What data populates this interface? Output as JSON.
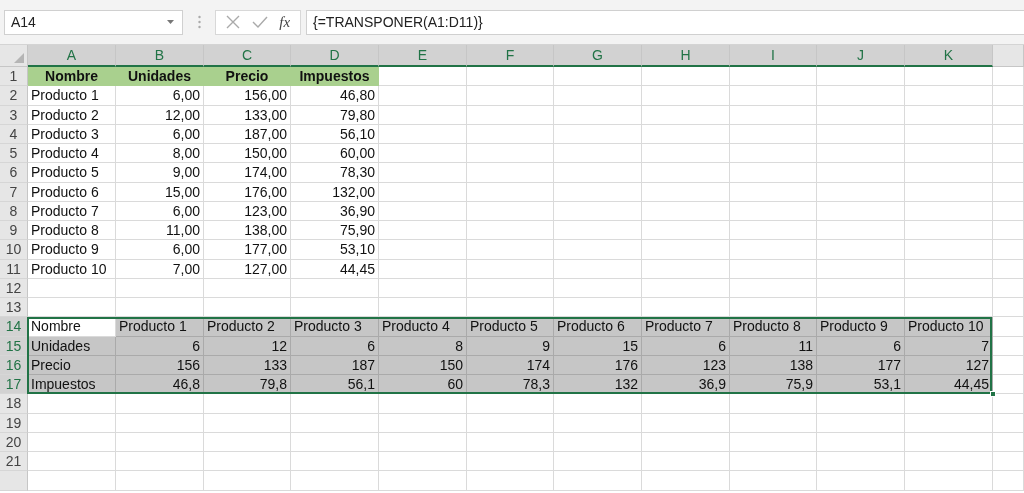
{
  "name_box": {
    "value": "A14"
  },
  "formula_bar": {
    "function_label": "fx",
    "formula": "{=TRANSPONER(A1:D11)}"
  },
  "columns": [
    {
      "letter": "A",
      "selected": true
    },
    {
      "letter": "B",
      "selected": true
    },
    {
      "letter": "C",
      "selected": true
    },
    {
      "letter": "D",
      "selected": true
    },
    {
      "letter": "E",
      "selected": true
    },
    {
      "letter": "F",
      "selected": true
    },
    {
      "letter": "G",
      "selected": true
    },
    {
      "letter": "H",
      "selected": true
    },
    {
      "letter": "I",
      "selected": true
    },
    {
      "letter": "J",
      "selected": true
    },
    {
      "letter": "K",
      "selected": true
    }
  ],
  "rows": [
    {
      "number": "1",
      "selected": false,
      "cells": [
        {
          "kind": "header",
          "text": "Nombre"
        },
        {
          "kind": "header",
          "text": "Unidades"
        },
        {
          "kind": "header",
          "text": "Precio"
        },
        {
          "kind": "header",
          "text": "Impuestos"
        }
      ]
    },
    {
      "number": "2",
      "selected": false,
      "cells": [
        {
          "kind": "text",
          "text": "Producto 1"
        },
        {
          "kind": "number",
          "text": "6,00"
        },
        {
          "kind": "number",
          "text": "156,00"
        },
        {
          "kind": "number",
          "text": "46,80"
        }
      ]
    },
    {
      "number": "3",
      "selected": false,
      "cells": [
        {
          "kind": "text",
          "text": "Producto 2"
        },
        {
          "kind": "number",
          "text": "12,00"
        },
        {
          "kind": "number",
          "text": "133,00"
        },
        {
          "kind": "number",
          "text": "79,80"
        }
      ]
    },
    {
      "number": "4",
      "selected": false,
      "cells": [
        {
          "kind": "text",
          "text": "Producto 3"
        },
        {
          "kind": "number",
          "text": "6,00"
        },
        {
          "kind": "number",
          "text": "187,00"
        },
        {
          "kind": "number",
          "text": "56,10"
        }
      ]
    },
    {
      "number": "5",
      "selected": false,
      "cells": [
        {
          "kind": "text",
          "text": "Producto 4"
        },
        {
          "kind": "number",
          "text": "8,00"
        },
        {
          "kind": "number",
          "text": "150,00"
        },
        {
          "kind": "number",
          "text": "60,00"
        }
      ]
    },
    {
      "number": "6",
      "selected": false,
      "cells": [
        {
          "kind": "text",
          "text": "Producto 5"
        },
        {
          "kind": "number",
          "text": "9,00"
        },
        {
          "kind": "number",
          "text": "174,00"
        },
        {
          "kind": "number",
          "text": "78,30"
        }
      ]
    },
    {
      "number": "7",
      "selected": false,
      "cells": [
        {
          "kind": "text",
          "text": "Producto 6"
        },
        {
          "kind": "number",
          "text": "15,00"
        },
        {
          "kind": "number",
          "text": "176,00"
        },
        {
          "kind": "number",
          "text": "132,00"
        }
      ]
    },
    {
      "number": "8",
      "selected": false,
      "cells": [
        {
          "kind": "text",
          "text": "Producto 7"
        },
        {
          "kind": "number",
          "text": "6,00"
        },
        {
          "kind": "number",
          "text": "123,00"
        },
        {
          "kind": "number",
          "text": "36,90"
        }
      ]
    },
    {
      "number": "9",
      "selected": false,
      "cells": [
        {
          "kind": "text",
          "text": "Producto 8"
        },
        {
          "kind": "number",
          "text": "11,00"
        },
        {
          "kind": "number",
          "text": "138,00"
        },
        {
          "kind": "number",
          "text": "75,90"
        }
      ]
    },
    {
      "number": "10",
      "selected": false,
      "cells": [
        {
          "kind": "text",
          "text": "Producto 9"
        },
        {
          "kind": "number",
          "text": "6,00"
        },
        {
          "kind": "number",
          "text": "177,00"
        },
        {
          "kind": "number",
          "text": "53,10"
        }
      ]
    },
    {
      "number": "11",
      "selected": false,
      "cells": [
        {
          "kind": "text",
          "text": "Producto 10"
        },
        {
          "kind": "number",
          "text": "7,00"
        },
        {
          "kind": "number",
          "text": "127,00"
        },
        {
          "kind": "number",
          "text": "44,45"
        }
      ]
    },
    {
      "number": "12",
      "selected": false,
      "cells": []
    },
    {
      "number": "13",
      "selected": false,
      "cells": []
    },
    {
      "number": "14",
      "selected": true,
      "cells": [
        {
          "kind": "text",
          "text": "Nombre",
          "active": true
        },
        {
          "kind": "text",
          "text": "Producto 1",
          "active": false
        },
        {
          "kind": "text",
          "text": "Producto 2",
          "active": false
        },
        {
          "kind": "text",
          "text": "Producto 3",
          "active": false
        },
        {
          "kind": "text",
          "text": "Producto 4",
          "active": false
        },
        {
          "kind": "text",
          "text": "Producto 5",
          "active": false
        },
        {
          "kind": "text",
          "text": "Producto 6",
          "active": false
        },
        {
          "kind": "text",
          "text": "Producto 7",
          "active": false
        },
        {
          "kind": "text",
          "text": "Producto 8",
          "active": false
        },
        {
          "kind": "text",
          "text": "Producto 9",
          "active": false
        },
        {
          "kind": "text",
          "text": "Producto 10",
          "active": false
        }
      ]
    },
    {
      "number": "15",
      "selected": true,
      "cells": [
        {
          "kind": "text",
          "text": "Unidades",
          "active": false
        },
        {
          "kind": "number",
          "text": "6",
          "active": false
        },
        {
          "kind": "number",
          "text": "12",
          "active": false
        },
        {
          "kind": "number",
          "text": "6",
          "active": false
        },
        {
          "kind": "number",
          "text": "8",
          "active": false
        },
        {
          "kind": "number",
          "text": "9",
          "active": false
        },
        {
          "kind": "number",
          "text": "15",
          "active": false
        },
        {
          "kind": "number",
          "text": "6",
          "active": false
        },
        {
          "kind": "number",
          "text": "11",
          "active": false
        },
        {
          "kind": "number",
          "text": "6",
          "active": false
        },
        {
          "kind": "number",
          "text": "7",
          "active": false
        }
      ]
    },
    {
      "number": "16",
      "selected": true,
      "cells": [
        {
          "kind": "text",
          "text": "Precio",
          "active": false
        },
        {
          "kind": "number",
          "text": "156",
          "active": false
        },
        {
          "kind": "number",
          "text": "133",
          "active": false
        },
        {
          "kind": "number",
          "text": "187",
          "active": false
        },
        {
          "kind": "number",
          "text": "150",
          "active": false
        },
        {
          "kind": "number",
          "text": "174",
          "active": false
        },
        {
          "kind": "number",
          "text": "176",
          "active": false
        },
        {
          "kind": "number",
          "text": "123",
          "active": false
        },
        {
          "kind": "number",
          "text": "138",
          "active": false
        },
        {
          "kind": "number",
          "text": "177",
          "active": false
        },
        {
          "kind": "number",
          "text": "127",
          "active": false
        }
      ]
    },
    {
      "number": "17",
      "selected": true,
      "cells": [
        {
          "kind": "text",
          "text": "Impuestos",
          "active": false
        },
        {
          "kind": "number",
          "text": "46,8",
          "active": false
        },
        {
          "kind": "number",
          "text": "79,8",
          "active": false
        },
        {
          "kind": "number",
          "text": "56,1",
          "active": false
        },
        {
          "kind": "number",
          "text": "60",
          "active": false
        },
        {
          "kind": "number",
          "text": "78,3",
          "active": false
        },
        {
          "kind": "number",
          "text": "132",
          "active": false
        },
        {
          "kind": "number",
          "text": "36,9",
          "active": false
        },
        {
          "kind": "number",
          "text": "75,9",
          "active": false
        },
        {
          "kind": "number",
          "text": "53,1",
          "active": false
        },
        {
          "kind": "number",
          "text": "44,45",
          "active": false
        }
      ]
    },
    {
      "number": "18",
      "selected": false,
      "cells": []
    },
    {
      "number": "19",
      "selected": false,
      "cells": []
    },
    {
      "number": "20",
      "selected": false,
      "cells": []
    },
    {
      "number": "21",
      "selected": false,
      "cells": []
    }
  ]
}
